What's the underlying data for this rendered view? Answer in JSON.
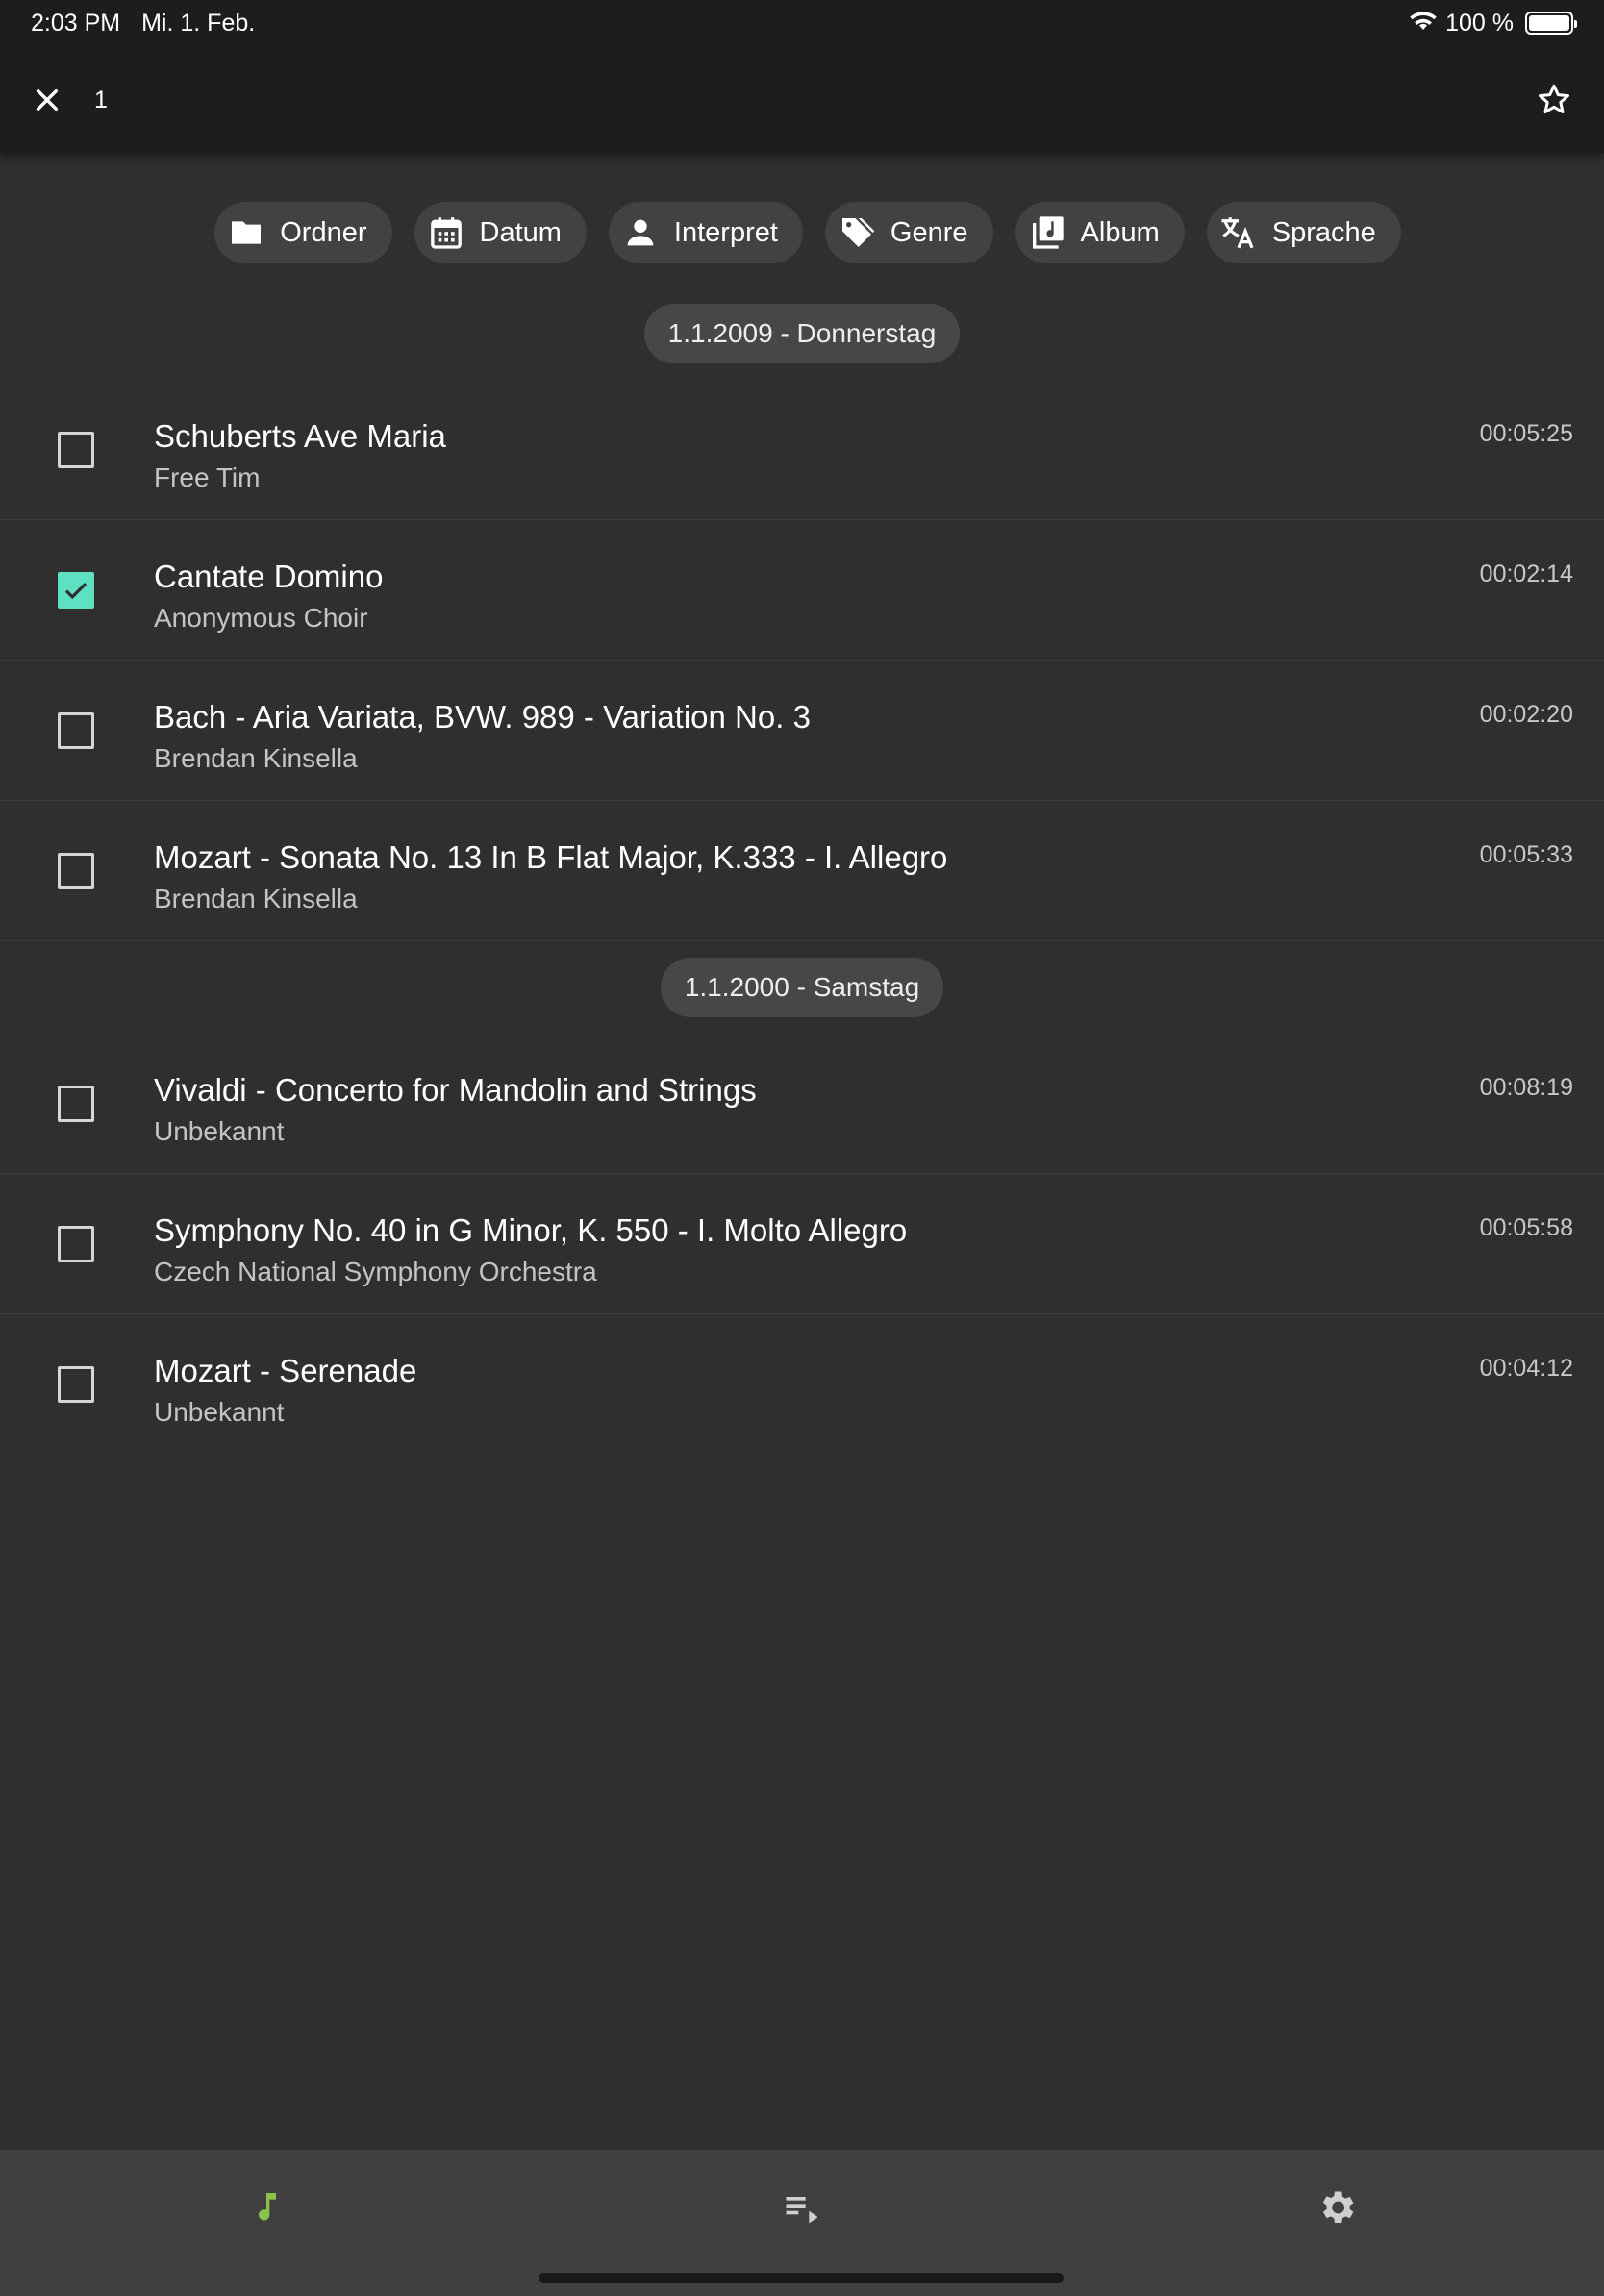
{
  "status_bar": {
    "time": "2:03 PM",
    "date": "Mi. 1. Feb.",
    "battery": "100 %",
    "battery_level": 1.0
  },
  "app_bar": {
    "selected_count": "1",
    "close_icon": "close-icon",
    "star_icon": "star-outline-icon"
  },
  "filters": [
    {
      "label": "Ordner",
      "icon": "folder-icon"
    },
    {
      "label": "Datum",
      "icon": "calendar-icon"
    },
    {
      "label": "Interpret",
      "icon": "person-icon"
    },
    {
      "label": "Genre",
      "icon": "tag-icon"
    },
    {
      "label": "Album",
      "icon": "album-icon"
    },
    {
      "label": "Sprache",
      "icon": "translate-icon"
    }
  ],
  "groups": [
    {
      "date": "1.1.2009 - Donnerstag",
      "tracks": [
        {
          "title": "Schuberts Ave Maria",
          "artist": "Free Tim",
          "duration": "00:05:25",
          "checked": false
        },
        {
          "title": "Cantate Domino",
          "artist": "Anonymous Choir",
          "duration": "00:02:14",
          "checked": true
        },
        {
          "title": "Bach - Aria Variata, BVW. 989 - Variation No. 3",
          "artist": "Brendan Kinsella",
          "duration": "00:02:20",
          "checked": false
        },
        {
          "title": "Mozart - Sonata No. 13 In B Flat Major, K.333 - I. Allegro",
          "artist": "Brendan Kinsella",
          "duration": "00:05:33",
          "checked": false
        }
      ]
    },
    {
      "date": "1.1.2000 - Samstag",
      "tracks": [
        {
          "title": "Vivaldi - Concerto for Mandolin and Strings",
          "artist": "Unbekannt",
          "duration": "00:08:19",
          "checked": false
        },
        {
          "title": "Symphony No. 40 in G Minor, K. 550 - I. Molto Allegro",
          "artist": "Czech National Symphony Orchestra",
          "duration": "00:05:58",
          "checked": false
        },
        {
          "title": "Mozart - Serenade",
          "artist": "Unbekannt",
          "duration": "00:04:12",
          "checked": false
        }
      ]
    }
  ],
  "bottom_nav": [
    {
      "icon": "music-note-icon",
      "active": true
    },
    {
      "icon": "playlist-play-icon",
      "active": false
    },
    {
      "icon": "settings-gear-icon",
      "active": false
    }
  ],
  "colors": {
    "background": "#2f2f2f",
    "app_bar": "#1b1d1f",
    "chip": "#424242",
    "checkbox_checked": "#5ee0c2",
    "nav_active": "#8bc34a",
    "nav_inactive": "#cfcfcf",
    "bottom_nav": "#404040"
  }
}
